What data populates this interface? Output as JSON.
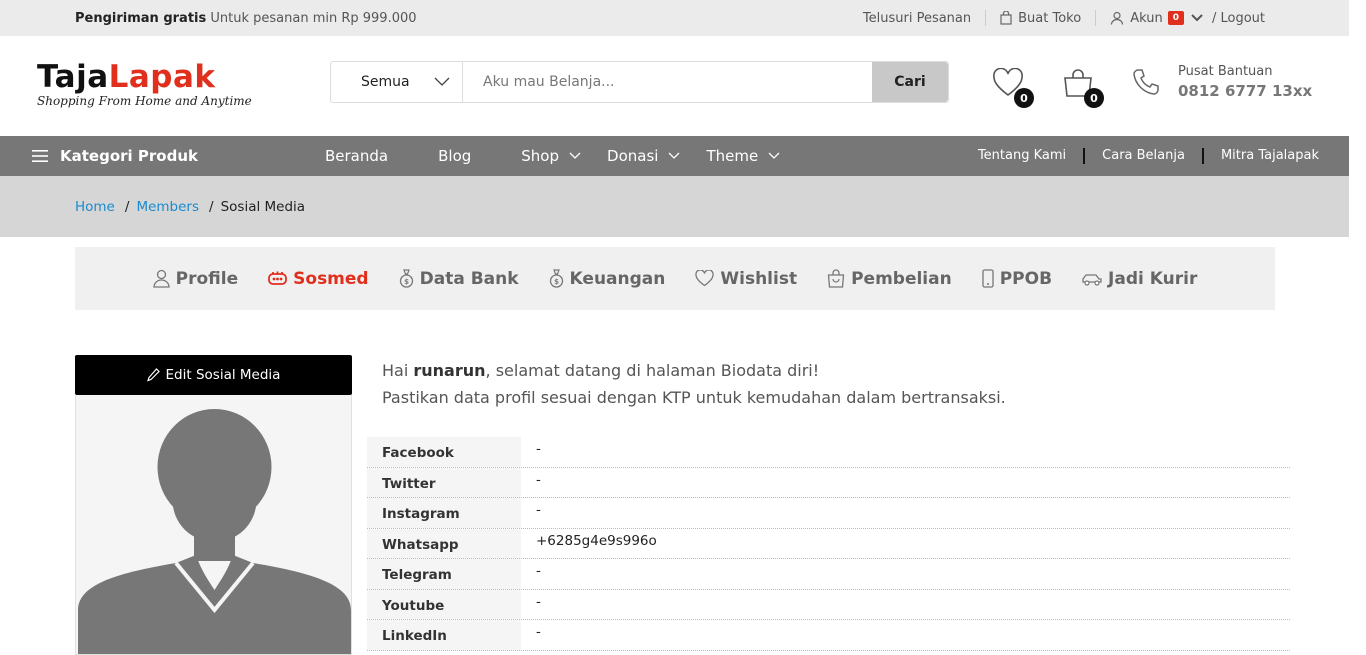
{
  "topbar": {
    "shipping_bold": "Pengiriman gratis",
    "shipping_text": "Untuk pesanan min Rp 999.000",
    "track_order": "Telusuri Pesanan",
    "create_store": "Buat Toko",
    "account": "Akun",
    "account_badge": "0",
    "logout": "/ Logout"
  },
  "header": {
    "logo_part1": "Taja",
    "logo_part2": "Lapak",
    "logo_tagline": "Shopping From Home and Anytime",
    "search_category": "Semua",
    "search_placeholder": "Aku mau Belanja...",
    "search_button": "Cari",
    "wishlist_count": "0",
    "cart_count": "0",
    "help_title": "Pusat Bantuan",
    "help_phone": "0812 6777 13xx"
  },
  "nav": {
    "categories": "Kategori Produk",
    "menu": [
      "Beranda",
      "Blog",
      "Shop",
      "Donasi",
      "Theme"
    ],
    "right_menu": [
      "Tentang Kami",
      "Cara Belanja",
      "Mitra Tajalapak"
    ]
  },
  "breadcrumb": {
    "home": "Home",
    "members": "Members",
    "current": "Sosial Media"
  },
  "tabs": [
    "Profile",
    "Sosmed",
    "Data Bank",
    "Keuangan",
    "Wishlist",
    "Pembelian",
    "PPOB",
    "Jadi Kurir"
  ],
  "sidebar": {
    "edit_button": "Edit Sosial Media"
  },
  "greeting": {
    "hai": "Hai",
    "username": "runarun",
    "line1_rest": ", selamat datang di halaman Biodata diri!",
    "line2": "Pastikan data profil sesuai dengan KTP untuk kemudahan dalam bertransaksi."
  },
  "social": [
    {
      "label": "Facebook",
      "value": "-"
    },
    {
      "label": "Twitter",
      "value": "-"
    },
    {
      "label": "Instagram",
      "value": "-"
    },
    {
      "label": "Whatsapp",
      "value": "+6285g4e9s996o"
    },
    {
      "label": "Telegram",
      "value": "-"
    },
    {
      "label": "Youtube",
      "value": "-"
    },
    {
      "label": "LinkedIn",
      "value": "-"
    }
  ],
  "colors": {
    "accent": "#e02f1d",
    "nav_bg": "#777777",
    "link": "#1a8bd0"
  }
}
